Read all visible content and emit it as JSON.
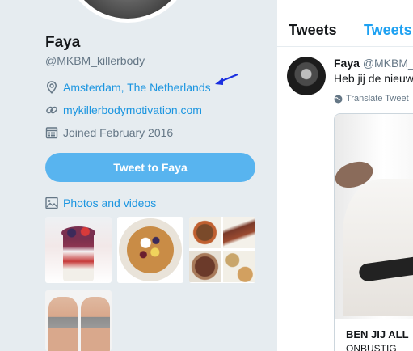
{
  "profile": {
    "name": "Faya",
    "handle": "@MKBM_killerbody",
    "location": "Amsterdam, The Netherlands",
    "website": "mykillerbodymotivation.com",
    "joined": "Joined February 2016",
    "tweet_to_label": "Tweet to Faya",
    "photos_label": "Photos and videos"
  },
  "icons": {
    "location": "location-pin-icon",
    "link": "link-icon",
    "calendar": "calendar-icon",
    "photos": "image-icon",
    "translate": "globe-icon",
    "annotation_arrow": "arrow-icon"
  },
  "colors": {
    "accent": "#1da1f2",
    "link": "#1b95e0",
    "button": "#58b4ef",
    "arrow": "#1a2fe0",
    "background": "#e6ecf0"
  },
  "timeline": {
    "tabs": [
      {
        "label": "Tweets"
      },
      {
        "label": "Tweets"
      }
    ],
    "tweet": {
      "author": "Faya",
      "handle": "@MKBM_k",
      "text": "Heb jij de nieuw",
      "translate": "Translate Tweet",
      "card_title": "BEN JIJ ALL",
      "card_sub": "ONBUSTIG"
    }
  }
}
